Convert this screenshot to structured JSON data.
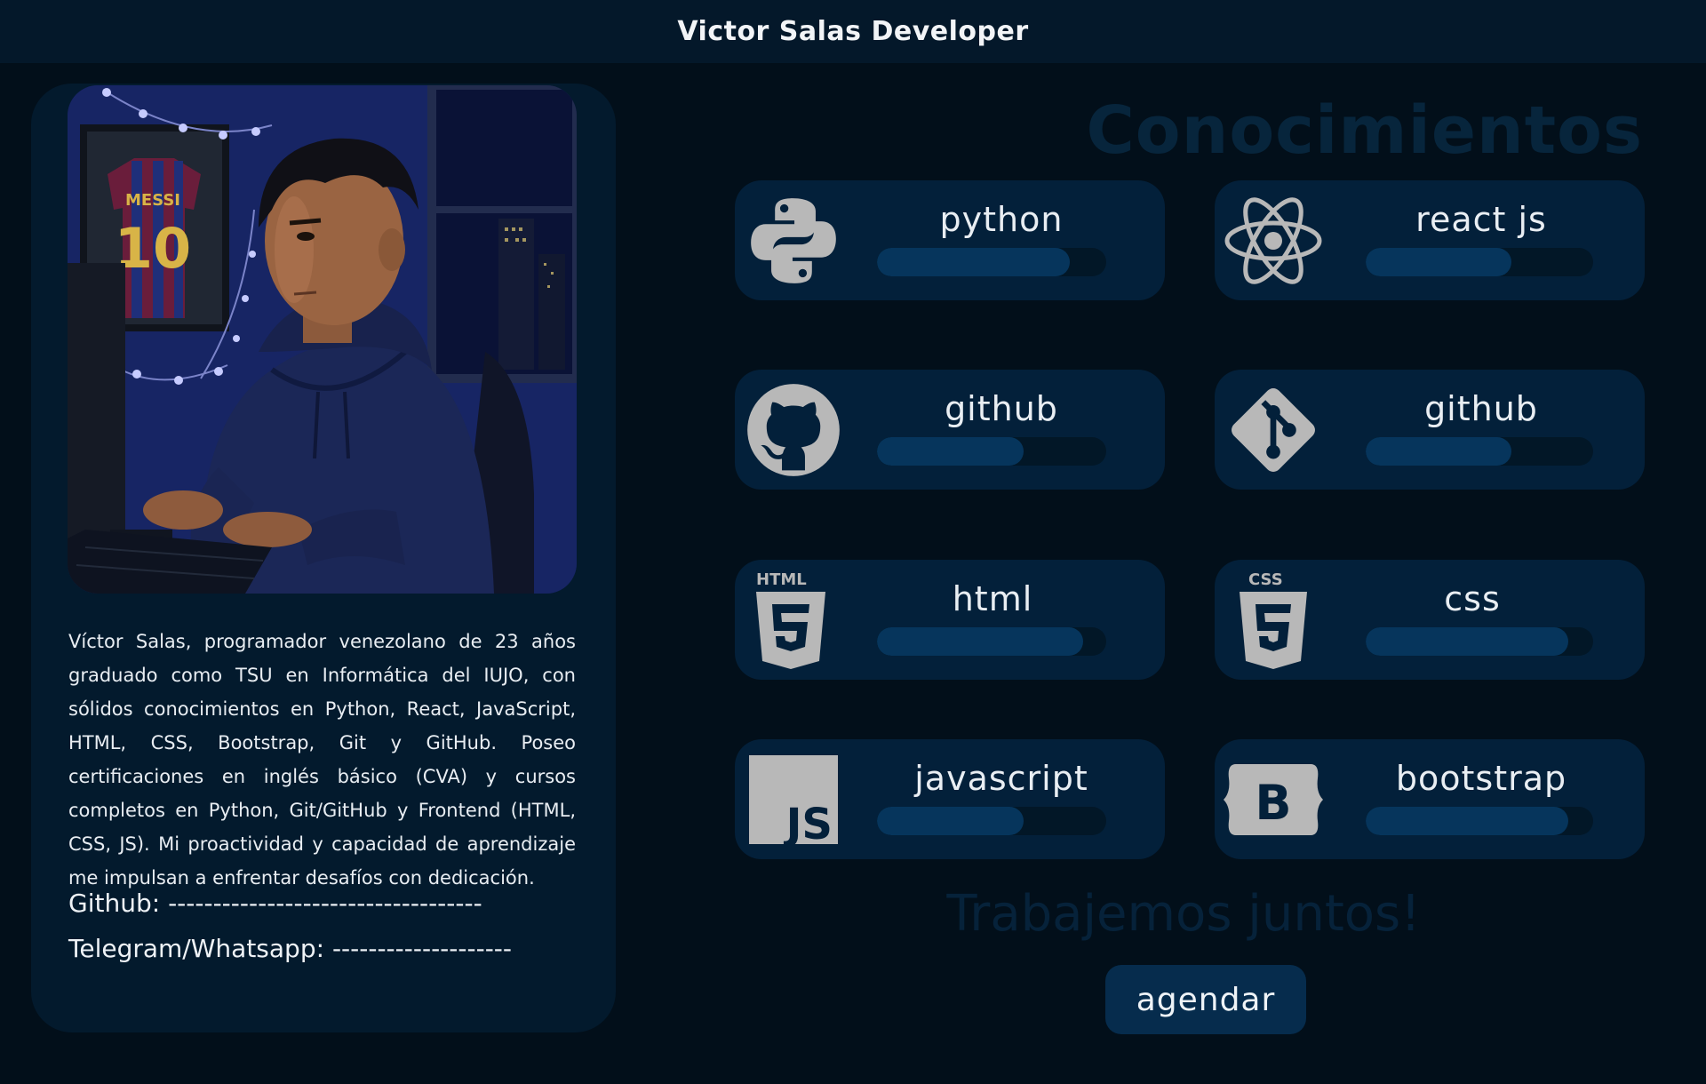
{
  "header": {
    "title": "Victor Salas Developer"
  },
  "profile": {
    "bio": "Víctor Salas, programador venezolano de 23 años graduado como TSU en Informática del IUJO, con sólidos conocimientos en Python, React, JavaScript, HTML, CSS, Bootstrap, Git y GitHub. Poseo certificaciones en inglés básico (CVA) y cursos completos en Python, Git/GitHub y Frontend (HTML, CSS, JS). Mi proactividad y capacidad de aprendizaje me impulsan a enfrentar desafíos con dedicación.",
    "github_label": "Github:",
    "github_value": "-----------------------------------",
    "contact_label": "Telegram/Whatsapp:",
    "contact_value": "--------------------",
    "shirt_name": "MESSI",
    "shirt_number": "10"
  },
  "skills_title": "Conocimientos",
  "skills": [
    {
      "name": "python",
      "icon": "python-icon",
      "level": 0.84
    },
    {
      "name": "react js",
      "icon": "react-icon",
      "level": 0.64
    },
    {
      "name": "github",
      "icon": "github-icon",
      "level": 0.64
    },
    {
      "name": "github",
      "icon": "git-icon",
      "level": 0.64
    },
    {
      "name": "html",
      "icon": "html5-icon",
      "level": 0.9
    },
    {
      "name": "css",
      "icon": "css3-icon",
      "level": 0.89
    },
    {
      "name": "javascript",
      "icon": "javascript-icon",
      "level": 0.64
    },
    {
      "name": "bootstrap",
      "icon": "bootstrap-icon",
      "level": 0.89
    }
  ],
  "icon_text": {
    "html": "HTML",
    "css": "CSS",
    "js": "JS",
    "bootstrap": "B"
  },
  "cta": {
    "title": "Trabajemos juntos!",
    "button_label": "agendar"
  },
  "colors": {
    "background": "#020f1a",
    "card": "#03203a",
    "bar_fill": "#06355c",
    "icon_gray": "#b8b8b8"
  }
}
